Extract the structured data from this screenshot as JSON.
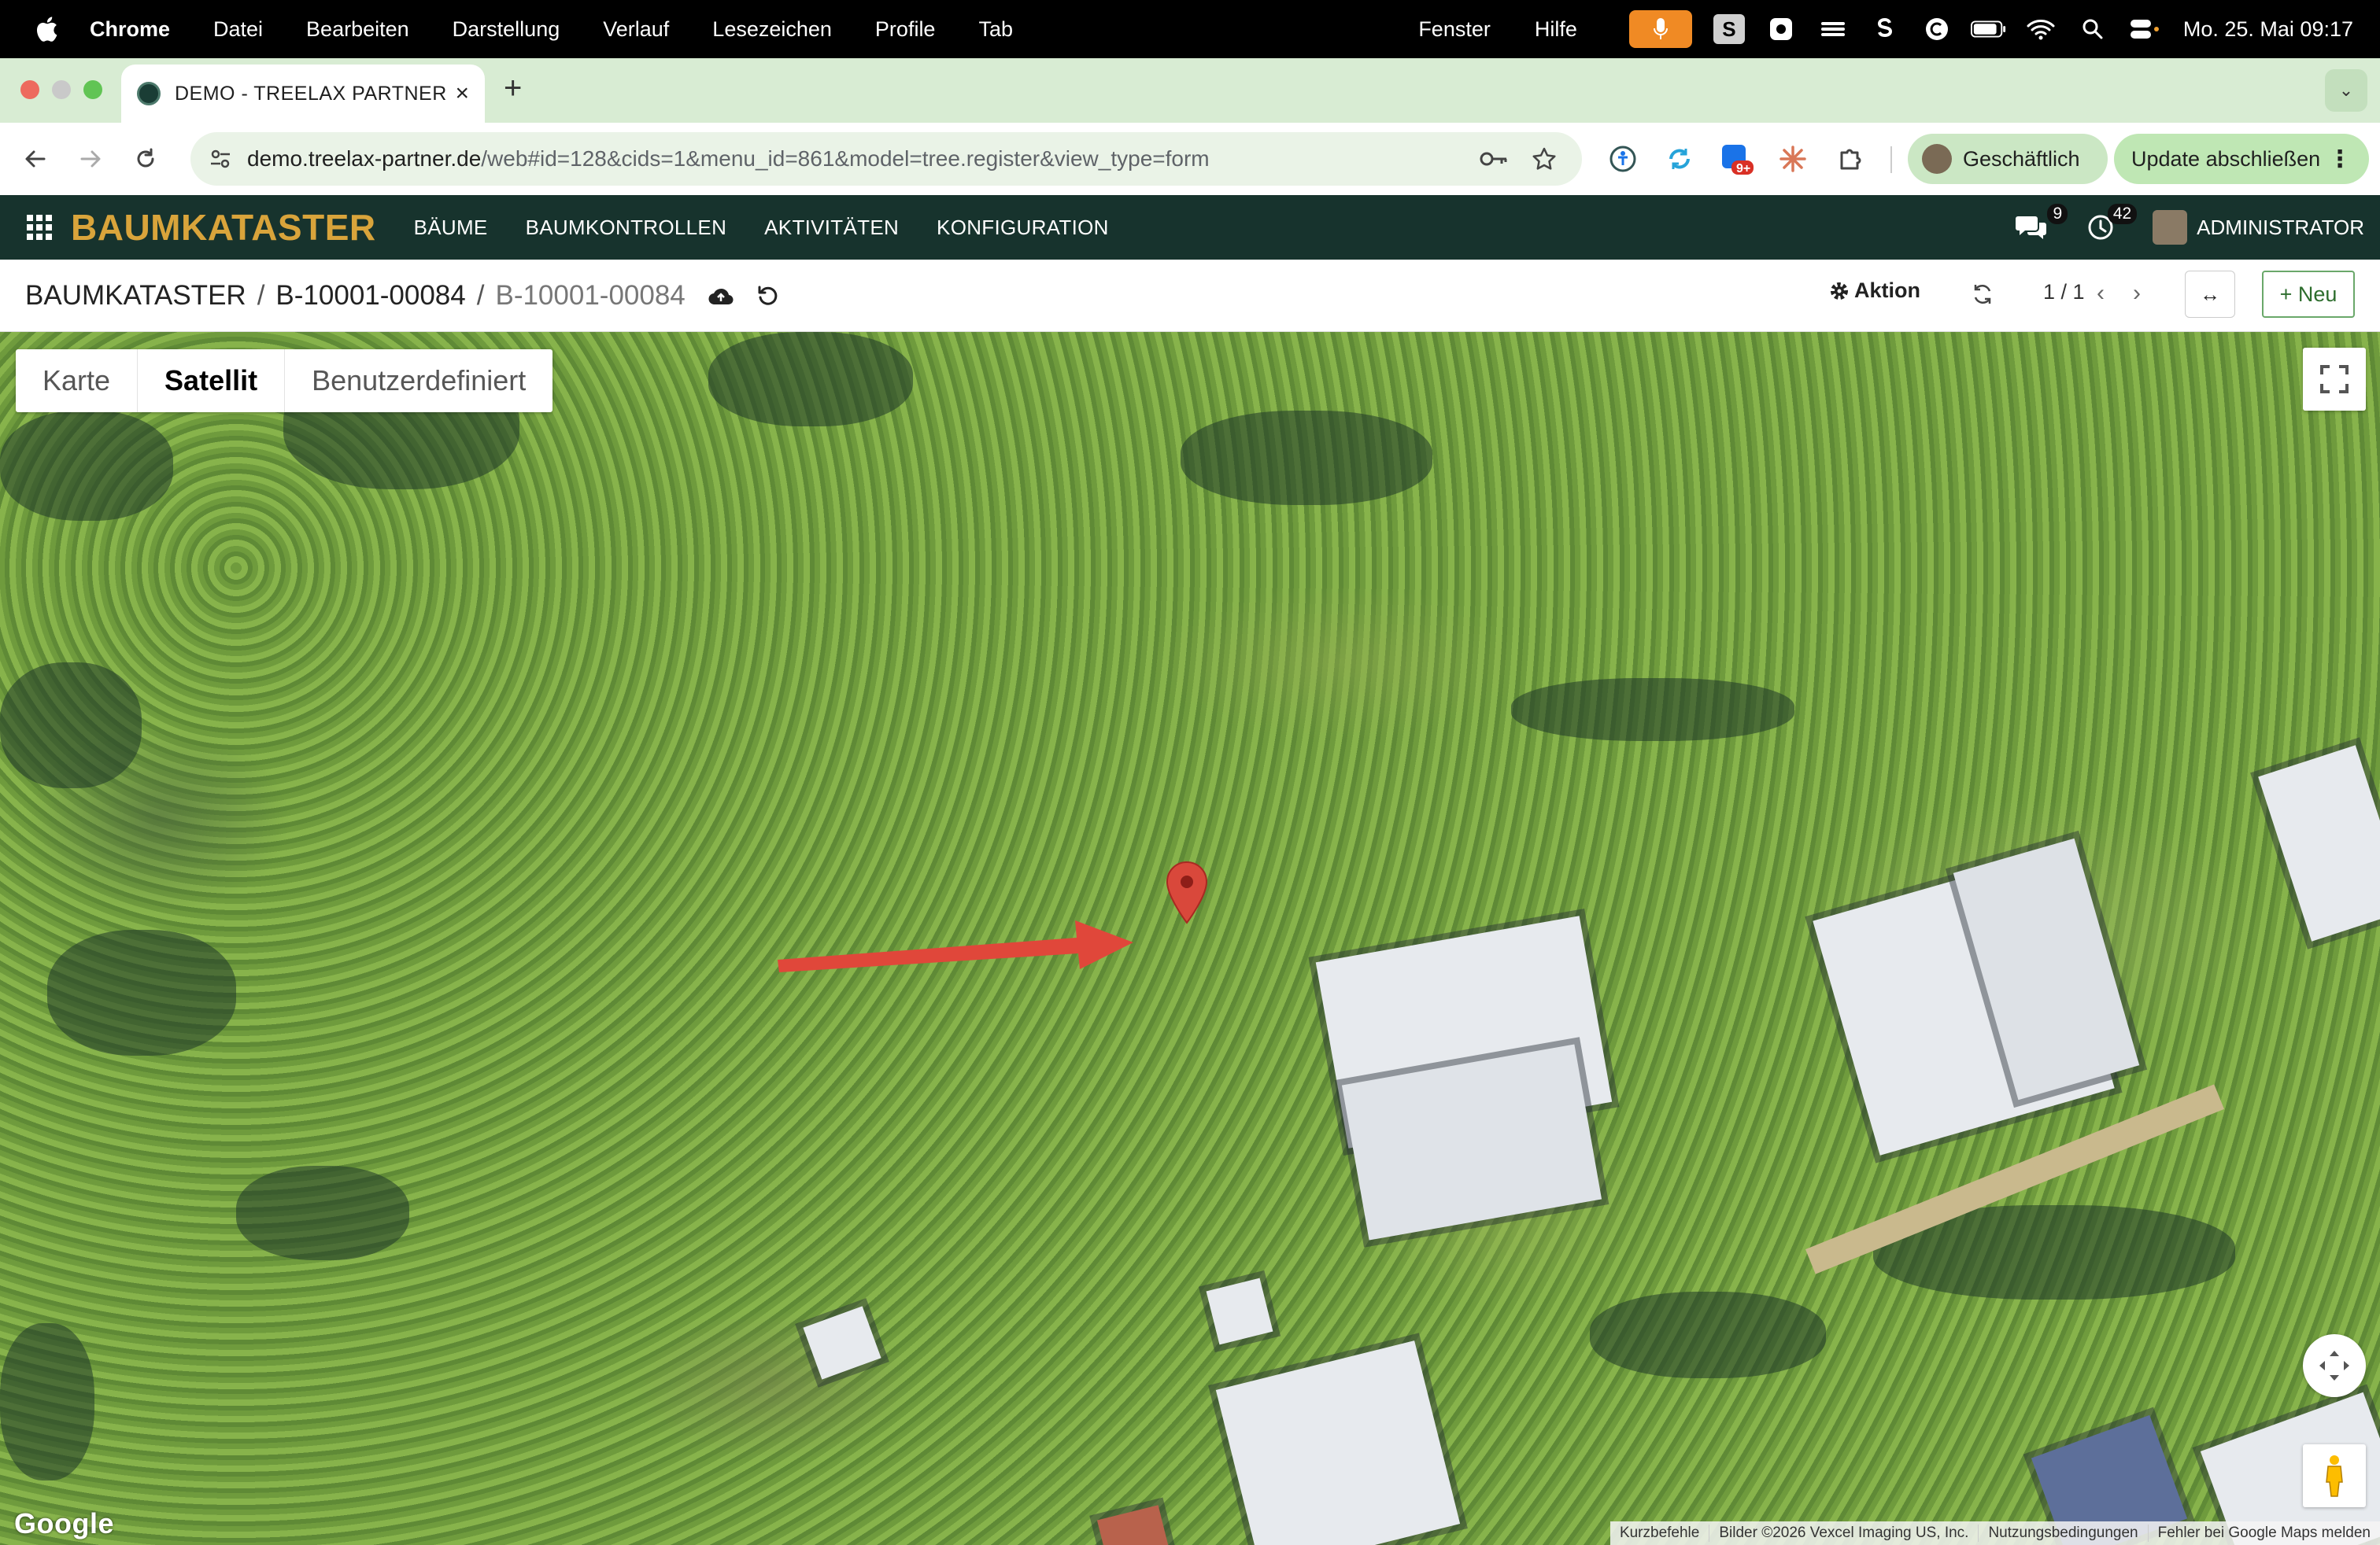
{
  "menubar": {
    "app": "Chrome",
    "items": [
      "Datei",
      "Bearbeiten",
      "Darstellung",
      "Verlauf",
      "Lesezeichen",
      "Profile",
      "Tab"
    ],
    "right_items": [
      "Fenster",
      "Hilfe"
    ],
    "tray_s": "S",
    "clock": "Mo. 25. Mai  09:17"
  },
  "browser": {
    "tab_title": "DEMO - TREELAX PARTNER -",
    "tab_close": "×",
    "new_tab": "+",
    "url_host": "demo.treelax-partner.de",
    "url_path": "/web#id=128&cids=1&menu_id=861&model=tree.register&view_type=form",
    "profile_label": "Geschäftlich",
    "update_label": "Update abschließen",
    "update_menu": "⋮",
    "tab_search": "⌄",
    "extension_badge": "9+"
  },
  "app": {
    "brand": "BAUMKATASTER",
    "nav": [
      "BÄUME",
      "BAUMKONTROLLEN",
      "AKTIVITÄTEN",
      "KONFIGURATION"
    ],
    "messages_count": "9",
    "activities_count": "42",
    "user": "ADMINISTRATOR"
  },
  "control_panel": {
    "breadcrumb": [
      "BAUMKATASTER",
      "B-10001-00084"
    ],
    "breadcrumb_sep": "/",
    "current": "B-10001-00084",
    "action_label": "Aktion",
    "pager": "1 / 1",
    "pager_prev": "‹",
    "pager_next": "›",
    "expand": "↔",
    "new_label": "+ Neu"
  },
  "map": {
    "map_types": [
      "Karte",
      "Satellit",
      "Benutzerdefiniert"
    ],
    "active_map_type": "Satellit",
    "logo": "Google",
    "attribution": [
      "Kurzbefehle",
      "Bilder ©2026 Vexcel Imaging US, Inc.",
      "Nutzungsbedingungen",
      "Fehler bei Google Maps melden"
    ],
    "marker_color": "#d9483b",
    "arrow_color": "#e0473a"
  },
  "colors": {
    "navbar": "#17332d",
    "brand": "#d9a43b",
    "tabstrip": "#d8ecd3"
  }
}
